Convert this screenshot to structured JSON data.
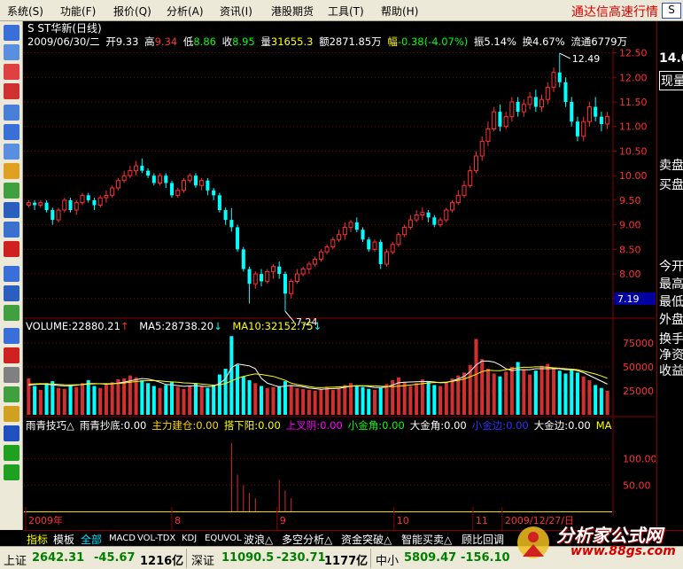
{
  "menu": {
    "items": [
      "系统(S)",
      "功能(F)",
      "报价(Q)",
      "分析(A)",
      "资讯(I)",
      "港股期货",
      "工具(T)",
      "帮助(H)"
    ],
    "app_title": "通达信高速行情",
    "close_label": "S"
  },
  "header": {
    "stock_name": "S ST华新(日线)",
    "date": "2009/06/30/二",
    "open_label": "开",
    "open": "9.33",
    "high_label": "高",
    "high": "9.34",
    "low_label": "低",
    "low": "8.86",
    "close_label": "收",
    "close": "8.95",
    "volume_label": "量",
    "volume": "31655.3",
    "amount_label": "额",
    "amount": "2871.85万",
    "change_label": "幅",
    "change": "-0.38(-4.07%)",
    "amplitude_label": "振",
    "amplitude": "5.14%",
    "turnover_label": "换",
    "turnover": "4.67%",
    "float_label": "流通",
    "float": "6779万"
  },
  "price_axis": [
    "12.50",
    "12.00",
    "11.50",
    "11.00",
    "10.50",
    "10.00",
    "9.50",
    "9.00",
    "8.50",
    "8.00",
    "7.50"
  ],
  "annotations": {
    "max": "12.49",
    "min": "7.24",
    "current_price": "7.19"
  },
  "volume_header": {
    "volume": "VOLUME:22880.21",
    "ma5": "MA5:28738.20",
    "ma10": "MA10:32152.75"
  },
  "volume_axis": [
    "75000",
    "50000",
    "25000"
  ],
  "indicator_header": [
    {
      "text": "雨青技巧△",
      "color": "#ffffff"
    },
    {
      "text": "雨青抄底:0.00",
      "color": "#ffffff"
    },
    {
      "text": "主力建仓:0.00",
      "color": "#ffd700"
    },
    {
      "text": "搭下阳:0.00",
      "color": "#ffff00"
    },
    {
      "text": "上叉阴:0.00",
      "color": "#ff00ff"
    },
    {
      "text": "小金角:0.00",
      "color": "#00ff00"
    },
    {
      "text": "大金角:0.00",
      "color": "#ffffff"
    },
    {
      "text": "小金边:0.00",
      "color": "#3030ff"
    },
    {
      "text": "大金边:0.00",
      "color": "#ffffff"
    },
    {
      "text": "MA",
      "color": "#ffff00"
    }
  ],
  "indicator_axis": [
    "100.00",
    "50.00"
  ],
  "time_axis": [
    {
      "label": "2009年"
    },
    {
      "label": "8"
    },
    {
      "label": "9"
    },
    {
      "label": "10"
    },
    {
      "label": "11"
    },
    {
      "label": "2009/12/27/日"
    }
  ],
  "right_panel": {
    "price": "14.0",
    "labels": [
      "现量",
      "卖盘",
      "买盘",
      "今开",
      "最高",
      "最低",
      "外盘",
      "换手",
      "净资",
      "收益"
    ]
  },
  "tabs": [
    "指标",
    "模板",
    "全部",
    "MACD",
    "VOL-TDX",
    "KDJ",
    "EQUVOL",
    "波浪△",
    "多空分析△",
    "资金突破△",
    "智能买卖△",
    "顾比回调"
  ],
  "active_tab": "全部",
  "status": {
    "sh_label": "上证",
    "sh_value": "2642.31",
    "sh_change": "-45.67",
    "sh_amount": "1216亿",
    "sz_label": "深证",
    "sz_value": "11090.5",
    "sz_change": "-230.71",
    "sz_amount": "1177亿",
    "zx_label": "中小",
    "zx_value": "5809.47",
    "zx_change": "-156.10"
  },
  "logo": {
    "text": "分析家公式网",
    "url": "www.88gs.com"
  },
  "colors": {
    "up": "#ff3030",
    "down": "#00ffff",
    "grid": "#8a0000",
    "ma5": "#ffffff",
    "ma10": "#ffff00",
    "axis_text": "#ff3030"
  },
  "chart_data": {
    "type": "candlestick",
    "price_ylim": [
      7.19,
      12.6
    ],
    "volume_ylim": [
      0,
      85000
    ],
    "indicator_ylim": [
      0,
      150
    ],
    "candles": [
      [
        9.4,
        9.45,
        9.35,
        9.5
      ],
      [
        9.45,
        9.4,
        9.3,
        9.5
      ],
      [
        9.4,
        9.45,
        9.35,
        9.5
      ],
      [
        9.45,
        9.3,
        9.25,
        9.5
      ],
      [
        9.3,
        9.1,
        9.0,
        9.35
      ],
      [
        9.1,
        9.3,
        9.05,
        9.35
      ],
      [
        9.3,
        9.5,
        9.25,
        9.55
      ],
      [
        9.5,
        9.3,
        9.25,
        9.55
      ],
      [
        9.3,
        9.45,
        9.2,
        9.5
      ],
      [
        9.45,
        9.6,
        9.4,
        9.65
      ],
      [
        9.6,
        9.5,
        9.45,
        9.65
      ],
      [
        9.5,
        9.4,
        9.3,
        9.55
      ],
      [
        9.4,
        9.55,
        9.35,
        9.6
      ],
      [
        9.55,
        9.6,
        9.45,
        9.7
      ],
      [
        9.6,
        9.75,
        9.55,
        9.8
      ],
      [
        9.75,
        9.9,
        9.7,
        9.95
      ],
      [
        9.9,
        10.0,
        9.85,
        10.1
      ],
      [
        10.0,
        10.1,
        9.95,
        10.2
      ],
      [
        10.1,
        10.2,
        10.0,
        10.3
      ],
      [
        10.2,
        10.1,
        10.05,
        10.35
      ],
      [
        10.1,
        10.0,
        9.95,
        10.15
      ],
      [
        10.0,
        9.85,
        9.8,
        10.05
      ],
      [
        9.85,
        10.0,
        9.8,
        10.05
      ],
      [
        10.0,
        9.85,
        9.75,
        10.05
      ],
      [
        9.85,
        9.6,
        9.55,
        9.9
      ],
      [
        9.6,
        9.7,
        9.55,
        9.75
      ],
      [
        9.7,
        9.9,
        9.65,
        9.95
      ],
      [
        9.9,
        10.0,
        9.85,
        10.05
      ],
      [
        10.0,
        9.8,
        9.75,
        10.05
      ],
      [
        9.8,
        9.9,
        9.7,
        9.95
      ],
      [
        9.9,
        9.7,
        9.6,
        9.95
      ],
      [
        9.7,
        9.6,
        9.5,
        9.75
      ],
      [
        9.6,
        9.3,
        9.25,
        9.65
      ],
      [
        9.3,
        9.1,
        9.0,
        9.35
      ],
      [
        9.1,
        8.95,
        8.86,
        9.34
      ],
      [
        8.95,
        8.5,
        8.45,
        9.0
      ],
      [
        8.5,
        8.1,
        8.05,
        8.55
      ],
      [
        8.1,
        7.8,
        7.4,
        8.15
      ],
      [
        7.8,
        8.0,
        7.7,
        8.05
      ],
      [
        8.0,
        7.85,
        7.75,
        8.1
      ],
      [
        7.85,
        8.05,
        7.8,
        8.1
      ],
      [
        8.05,
        8.15,
        7.9,
        8.2
      ],
      [
        8.15,
        8.0,
        7.9,
        8.25
      ],
      [
        8.0,
        7.6,
        7.24,
        8.05
      ],
      [
        7.6,
        7.85,
        7.5,
        7.9
      ],
      [
        7.85,
        8.0,
        7.8,
        8.1
      ],
      [
        8.0,
        8.1,
        7.95,
        8.15
      ],
      [
        8.1,
        8.2,
        8.0,
        8.25
      ],
      [
        8.2,
        8.3,
        8.15,
        8.35
      ],
      [
        8.3,
        8.45,
        8.25,
        8.5
      ],
      [
        8.45,
        8.55,
        8.4,
        8.6
      ],
      [
        8.55,
        8.7,
        8.5,
        8.75
      ],
      [
        8.7,
        8.8,
        8.65,
        8.9
      ],
      [
        8.8,
        8.95,
        8.7,
        9.05
      ],
      [
        8.95,
        9.05,
        8.85,
        9.1
      ],
      [
        9.05,
        8.9,
        8.85,
        9.15
      ],
      [
        8.9,
        8.7,
        8.65,
        8.95
      ],
      [
        8.7,
        8.5,
        8.45,
        8.75
      ],
      [
        8.5,
        8.65,
        8.45,
        8.7
      ],
      [
        8.65,
        8.2,
        8.1,
        8.7
      ],
      [
        8.2,
        8.45,
        8.15,
        8.5
      ],
      [
        8.45,
        8.6,
        8.4,
        8.65
      ],
      [
        8.6,
        8.8,
        8.55,
        8.85
      ],
      [
        8.8,
        8.95,
        8.75,
        9.0
      ],
      [
        8.95,
        9.1,
        8.9,
        9.2
      ],
      [
        9.1,
        9.2,
        9.05,
        9.3
      ],
      [
        9.2,
        9.25,
        9.1,
        9.35
      ],
      [
        9.25,
        9.15,
        9.05,
        9.3
      ],
      [
        9.15,
        9.0,
        8.95,
        9.2
      ],
      [
        9.0,
        9.1,
        8.95,
        9.15
      ],
      [
        9.1,
        9.3,
        9.05,
        9.35
      ],
      [
        9.3,
        9.45,
        9.25,
        9.5
      ],
      [
        9.45,
        9.6,
        9.4,
        9.7
      ],
      [
        9.6,
        9.8,
        9.55,
        9.9
      ],
      [
        9.8,
        10.1,
        9.75,
        10.2
      ],
      [
        10.1,
        10.4,
        10.05,
        10.5
      ],
      [
        10.4,
        10.7,
        10.3,
        10.8
      ],
      [
        10.7,
        10.95,
        10.6,
        11.1
      ],
      [
        10.95,
        11.3,
        10.9,
        11.4
      ],
      [
        11.3,
        11.0,
        10.9,
        11.45
      ],
      [
        11.0,
        11.2,
        10.95,
        11.3
      ],
      [
        11.2,
        11.5,
        11.1,
        11.6
      ],
      [
        11.5,
        11.3,
        11.2,
        11.6
      ],
      [
        11.3,
        11.45,
        11.2,
        11.55
      ],
      [
        11.45,
        11.6,
        11.35,
        11.7
      ],
      [
        11.6,
        11.4,
        11.3,
        11.75
      ],
      [
        11.4,
        11.55,
        11.3,
        11.65
      ],
      [
        11.55,
        11.8,
        11.45,
        11.9
      ],
      [
        11.8,
        12.1,
        11.7,
        12.2
      ],
      [
        12.1,
        11.9,
        11.8,
        12.49
      ],
      [
        11.9,
        11.5,
        11.4,
        12.0
      ],
      [
        11.5,
        11.1,
        11.0,
        11.6
      ],
      [
        11.1,
        10.8,
        10.7,
        11.2
      ],
      [
        10.8,
        11.1,
        10.7,
        11.2
      ],
      [
        11.1,
        11.4,
        11.0,
        11.5
      ],
      [
        11.4,
        11.2,
        11.1,
        11.6
      ],
      [
        11.2,
        11.05,
        10.9,
        11.3
      ],
      [
        11.05,
        11.2,
        10.95,
        11.3
      ]
    ],
    "volumes": [
      38000,
      30000,
      26000,
      33000,
      35000,
      28000,
      27000,
      31000,
      29000,
      33000,
      36000,
      30000,
      28000,
      32000,
      34000,
      37000,
      38000,
      41000,
      39000,
      36000,
      33000,
      30000,
      28000,
      31000,
      34000,
      29000,
      27000,
      30000,
      33000,
      30000,
      28000,
      31000,
      42000,
      48000,
      82000,
      52000,
      40000,
      36000,
      33000,
      30000,
      28000,
      29000,
      30000,
      35000,
      31000,
      28000,
      27000,
      26000,
      25000,
      27000,
      29000,
      26000,
      28000,
      31000,
      33000,
      30000,
      29000,
      27000,
      26000,
      28000,
      32000,
      36000,
      39000,
      34000,
      30000,
      33000,
      37000,
      35000,
      31000,
      30000,
      34000,
      38000,
      41000,
      44000,
      52000,
      79000,
      58000,
      48000,
      43000,
      40000,
      45000,
      50000,
      55000,
      47000,
      42000,
      46000,
      51000,
      53000,
      49000,
      46000,
      43000,
      48000,
      44000,
      40000,
      36000,
      31000,
      28000,
      25000
    ],
    "ma5": [
      31000,
      31500,
      32000,
      31800,
      31200,
      30500,
      30100,
      30300,
      30800,
      31600,
      32400,
      32600,
      32300,
      31900,
      32200,
      33000,
      34100,
      35300,
      36600,
      37800,
      37300,
      35900,
      33900,
      31600,
      31200,
      30400,
      29700,
      30000,
      30400,
      29800,
      29300,
      29800,
      32600,
      37600,
      49000,
      53000,
      52000,
      51000,
      48000,
      38000,
      33000,
      31000,
      29000,
      30000,
      30600,
      30000,
      29200,
      27800,
      27200,
      26600,
      27000,
      27200,
      27600,
      28600,
      29800,
      30400,
      30200,
      29400,
      28400,
      28400,
      29000,
      31000,
      33400,
      34000,
      34200,
      34400,
      34600,
      34800,
      34200,
      33400,
      33600,
      35200,
      37400,
      40000,
      45000,
      52000,
      56000,
      56000,
      55000,
      52000,
      48000,
      46000,
      47000,
      47000,
      47000,
      48000,
      48000,
      48000,
      48000,
      48000,
      47000,
      47000,
      46000,
      44000,
      41000,
      38000,
      35000,
      32000
    ],
    "ma10": [
      32000,
      32200,
      32400,
      32300,
      32000,
      31700,
      31300,
      31200,
      31300,
      31500,
      31900,
      32200,
      32400,
      32400,
      32500,
      32700,
      33200,
      33900,
      34600,
      35200,
      35700,
      35700,
      35300,
      34700,
      34300,
      33900,
      33300,
      33000,
      32700,
      32000,
      31400,
      30900,
      31300,
      32700,
      35200,
      38100,
      40000,
      41500,
      42600,
      42000,
      41000,
      40000,
      38000,
      36000,
      33000,
      31500,
      30500,
      29500,
      28500,
      28300,
      28600,
      28800,
      29100,
      29400,
      29800,
      30000,
      30300,
      30300,
      30100,
      29800,
      29400,
      29400,
      29800,
      30400,
      31100,
      31800,
      32500,
      33200,
      33600,
      33700,
      34100,
      34900,
      35900,
      37400,
      39600,
      42100,
      45100,
      46400,
      46100,
      46000,
      47000,
      48000,
      49000,
      49500,
      49500,
      50000,
      50000,
      49500,
      49000,
      48500,
      48000,
      47600,
      47000,
      45500,
      44000,
      42500,
      40500,
      38000
    ],
    "indicator_spikes": [
      [
        34,
        130
      ],
      [
        35,
        70
      ],
      [
        36,
        50
      ],
      [
        37,
        35
      ],
      [
        38,
        25
      ],
      [
        42,
        60
      ],
      [
        43,
        40
      ],
      [
        44,
        25
      ]
    ]
  }
}
